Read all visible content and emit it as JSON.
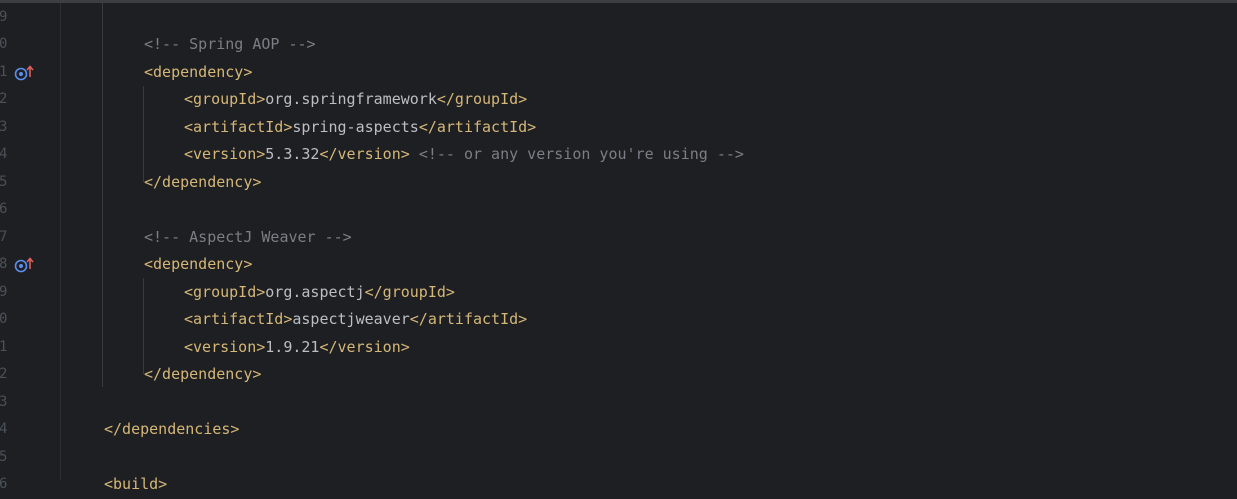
{
  "editor": {
    "lines": [
      {
        "num": "9",
        "indent": 0,
        "parts": []
      },
      {
        "num": "0",
        "indent": 2,
        "parts": [
          {
            "t": "cmt",
            "v": "<!-- Spring AOP -->"
          }
        ]
      },
      {
        "num": "1",
        "indent": 2,
        "gutter_icon": "maven-dependency-icon",
        "parts": [
          {
            "t": "tag",
            "v": "<dependency>"
          }
        ]
      },
      {
        "num": "2",
        "indent": 3,
        "parts": [
          {
            "t": "tag",
            "v": "<groupId>"
          },
          {
            "t": "txt",
            "v": "org.springframework"
          },
          {
            "t": "tag",
            "v": "</groupId>"
          }
        ]
      },
      {
        "num": "3",
        "indent": 3,
        "parts": [
          {
            "t": "tag",
            "v": "<artifactId>"
          },
          {
            "t": "txt",
            "v": "spring-aspects"
          },
          {
            "t": "tag",
            "v": "</artifactId>"
          }
        ]
      },
      {
        "num": "4",
        "indent": 3,
        "parts": [
          {
            "t": "tag",
            "v": "<version>"
          },
          {
            "t": "txt",
            "v": "5.3.32"
          },
          {
            "t": "tag",
            "v": "</version>"
          },
          {
            "t": "txt",
            "v": " "
          },
          {
            "t": "cmt",
            "v": "<!-- or any version you're using -->"
          }
        ]
      },
      {
        "num": "5",
        "indent": 2,
        "parts": [
          {
            "t": "tag",
            "v": "</dependency>"
          }
        ]
      },
      {
        "num": "6",
        "indent": 0,
        "parts": []
      },
      {
        "num": "7",
        "indent": 2,
        "parts": [
          {
            "t": "cmt",
            "v": "<!-- AspectJ Weaver -->"
          }
        ]
      },
      {
        "num": "8",
        "indent": 2,
        "gutter_icon": "maven-dependency-icon",
        "parts": [
          {
            "t": "tag",
            "v": "<dependency>"
          }
        ]
      },
      {
        "num": "9",
        "indent": 3,
        "parts": [
          {
            "t": "tag",
            "v": "<groupId>"
          },
          {
            "t": "txt",
            "v": "org.aspectj"
          },
          {
            "t": "tag",
            "v": "</groupId>"
          }
        ]
      },
      {
        "num": "0",
        "indent": 3,
        "parts": [
          {
            "t": "tag",
            "v": "<artifactId>"
          },
          {
            "t": "txt",
            "v": "aspectjweaver"
          },
          {
            "t": "tag",
            "v": "</artifactId>"
          }
        ]
      },
      {
        "num": "1",
        "indent": 3,
        "parts": [
          {
            "t": "tag",
            "v": "<version>"
          },
          {
            "t": "txt",
            "v": "1.9.21"
          },
          {
            "t": "tag",
            "v": "</version>"
          }
        ]
      },
      {
        "num": "2",
        "indent": 2,
        "parts": [
          {
            "t": "tag",
            "v": "</dependency>"
          }
        ]
      },
      {
        "num": "3",
        "indent": 0,
        "parts": []
      },
      {
        "num": "4",
        "indent": 1,
        "parts": [
          {
            "t": "tag",
            "v": "</dependencies>"
          }
        ]
      },
      {
        "num": "5",
        "indent": 0,
        "parts": []
      },
      {
        "num": "6",
        "indent": 1,
        "parts": [
          {
            "t": "tag",
            "v": "<build>"
          }
        ]
      }
    ]
  },
  "colors": {
    "background": "#1e1f22",
    "tag": "#d5b778",
    "text": "#bcbec4",
    "comment": "#7a7e85",
    "line_number": "#4b5059"
  }
}
